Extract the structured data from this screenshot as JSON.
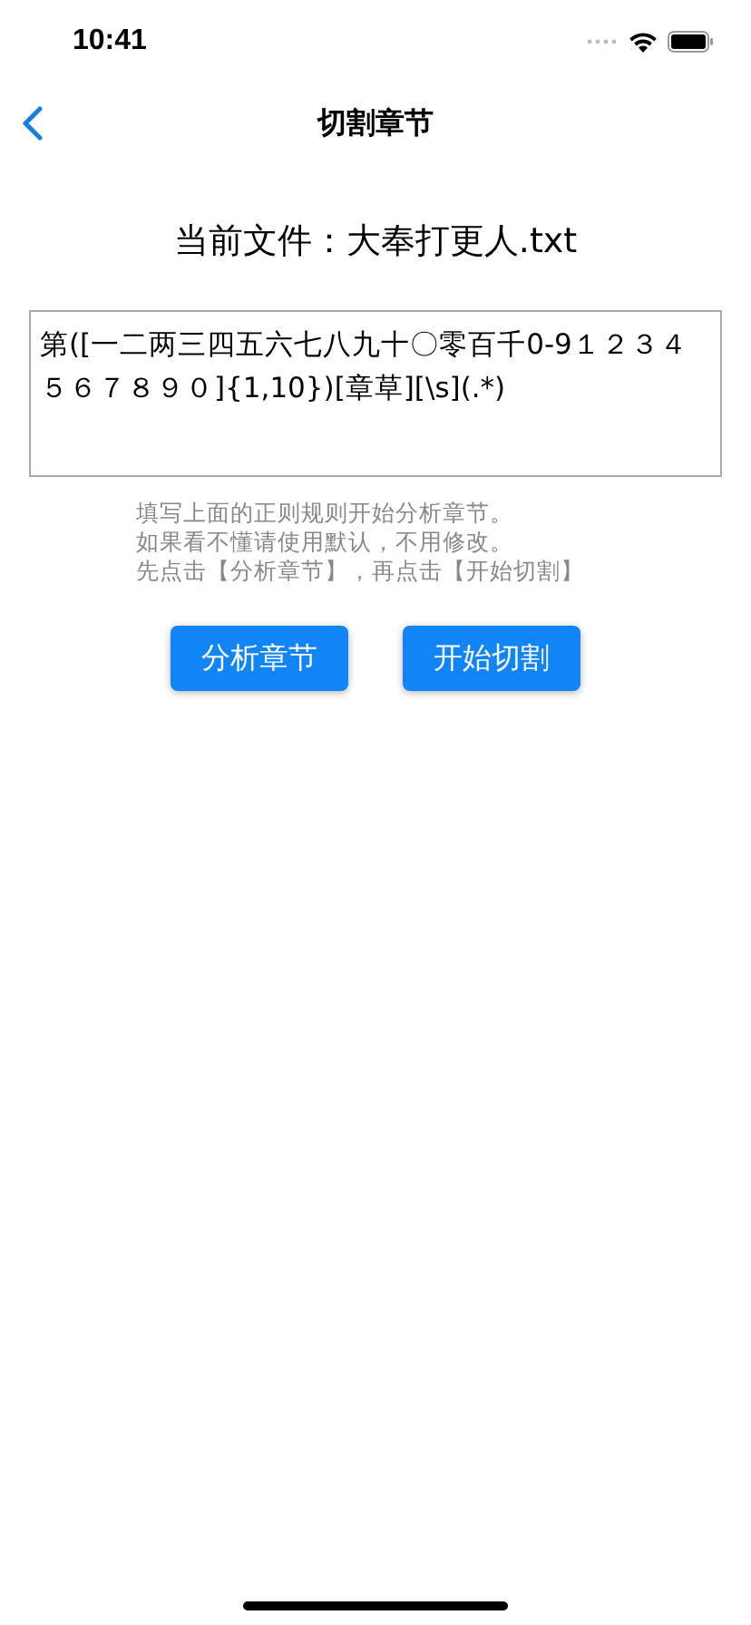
{
  "status_bar": {
    "time": "10:41"
  },
  "nav": {
    "title": "切割章节"
  },
  "current_file": "当前文件：大奉打更人.txt",
  "regex_field": {
    "value": "第([一二两三四五六七八九十〇零百千0-9１２３４５６７８９０]{1,10})[章草][\\s](.*)"
  },
  "hints": [
    "填写上面的正则规则开始分析章节。",
    "如果看不懂请使用默认，不用修改。",
    "先点击【分析章节】，再点击【开始切割】"
  ],
  "buttons": [
    "分析章节",
    "开始切割"
  ]
}
